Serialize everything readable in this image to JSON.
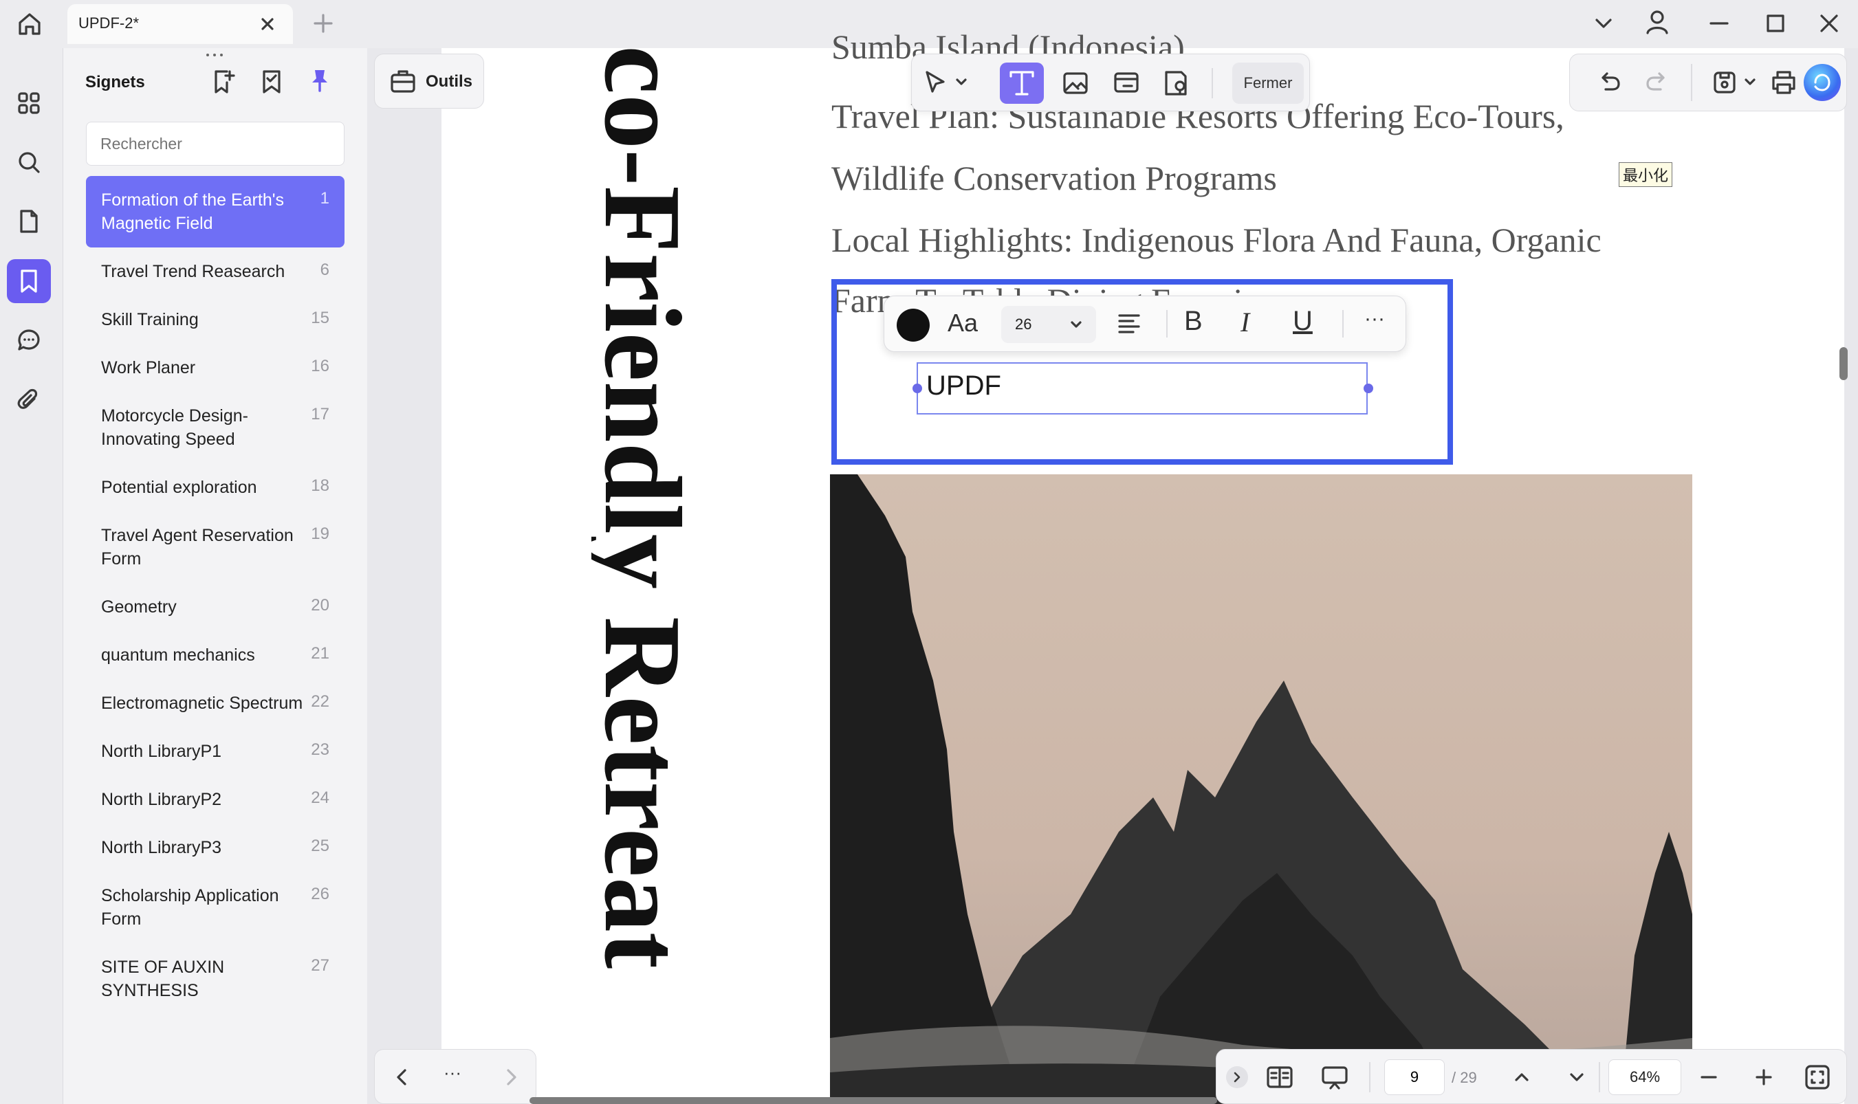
{
  "titlebar": {
    "tab_title": "UPDF-2*"
  },
  "panel": {
    "title": "Signets",
    "search_placeholder": "Rechercher",
    "bookmarks": [
      {
        "label": "Formation of the Earth's Magnetic Field",
        "page": "1",
        "active": true
      },
      {
        "label": "Travel Trend Reasearch",
        "page": "6"
      },
      {
        "label": "Skill Training",
        "page": "15"
      },
      {
        "label": "Work Planer",
        "page": "16"
      },
      {
        "label": "Motorcycle Design-Innovating Speed",
        "page": "17"
      },
      {
        "label": "Potential exploration",
        "page": "18"
      },
      {
        "label": "Travel Agent Reservation Form",
        "page": "19"
      },
      {
        "label": "Geometry",
        "page": "20"
      },
      {
        "label": "quantum mechanics",
        "page": "21"
      },
      {
        "label": "Electromagnetic Spectrum",
        "page": "22"
      },
      {
        "label": "North LibraryP1",
        "page": "23"
      },
      {
        "label": "North LibraryP2",
        "page": "24"
      },
      {
        "label": "North LibraryP3",
        "page": "25"
      },
      {
        "label": "Scholarship Application Form",
        "page": "26"
      },
      {
        "label": "SITE OF AUXIN SYNTHESIS",
        "page": "27"
      }
    ]
  },
  "toolbar": {
    "outils_label": "Outils",
    "close_label": "Fermer"
  },
  "document": {
    "vertical_title": "co-Friendly Retreat",
    "lines": [
      "Sumba Island (Indonesia)",
      "Travel Plan: Sustainable Resorts Offering Eco-Tours,",
      "Wildlife Conservation Programs",
      "Local Highlights: Indigenous Flora And Fauna, Organic",
      "Farm-To-Table Dining Experience"
    ],
    "cjk_label": "最小化",
    "edit_text": "UPDF"
  },
  "format_bar": {
    "font_size": "26"
  },
  "pagination": {
    "current_page": "9",
    "total": "/ 29",
    "zoom": "64%"
  },
  "colors": {
    "accent": "#6a5cf0",
    "selection": "#3f5bea",
    "active_bookmark": "#6f6ff5"
  }
}
